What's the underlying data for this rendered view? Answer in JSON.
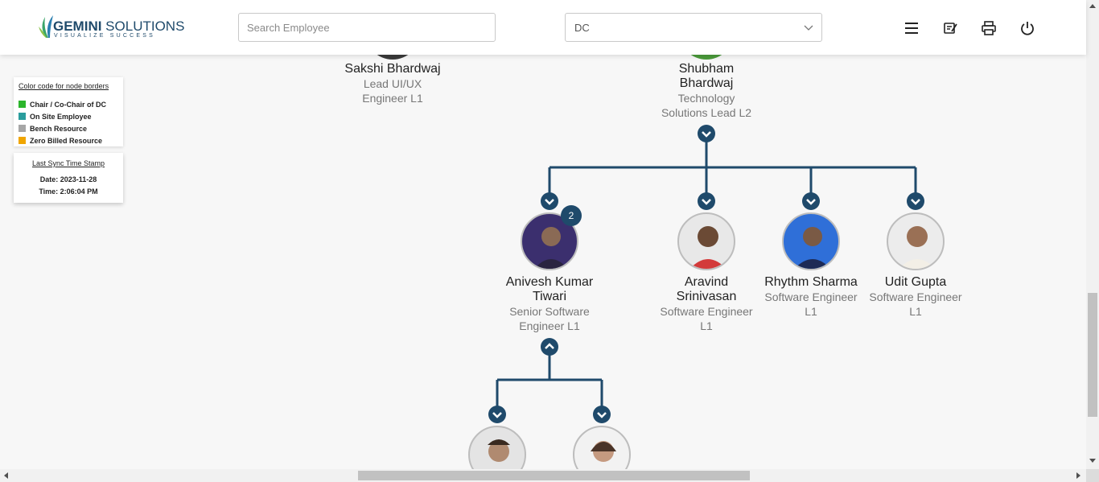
{
  "header": {
    "logo_main_bold": "GEMINI",
    "logo_main_rest": " SOLUTIONS",
    "logo_tagline": "VISUALIZE SUCCESS",
    "search_placeholder": "Search Employee",
    "search_value": "",
    "dropdown_value": "DC",
    "icons": [
      "menu-icon",
      "edit-note-icon",
      "print-icon",
      "power-icon"
    ]
  },
  "legend": {
    "title": "Color code for node borders",
    "items": [
      {
        "label": "Chair / Co-Chair of DC",
        "color": "#2bb52b"
      },
      {
        "label": "On Site Employee",
        "color": "#2a9d9d"
      },
      {
        "label": "Bench Resource",
        "color": "#a6a6a6"
      },
      {
        "label": "Zero Billed Resource",
        "color": "#f0a500"
      }
    ]
  },
  "sync": {
    "title": "Last Sync Time Stamp",
    "date": "Date: 2023-11-28",
    "time": "Time: 2:06:04 PM"
  },
  "colors": {
    "connector": "#1f4a6b",
    "accent": "#1f4a6b"
  },
  "tree": {
    "top_left": {
      "name": "Sakshi Bhardwaj",
      "title_line1": "Lead UI/UX",
      "title_line2": "Engineer L1"
    },
    "top_right": {
      "name_line1": "Shubham",
      "name_line2": "Bhardwaj",
      "title_line1": "Technology",
      "title_line2": "Solutions Lead L2"
    },
    "children": [
      {
        "name_line1": "Anivesh Kumar",
        "name_line2": "Tiwari",
        "title_line1": "Senior Software",
        "title_line2": "Engineer L1",
        "badge": "2"
      },
      {
        "name_line1": "Aravind",
        "name_line2": "Srinivasan",
        "title_line1": "Software Engineer",
        "title_line2": "L1"
      },
      {
        "name_line1": "Rhythm Sharma",
        "title_line1": "Software Engineer",
        "title_line2": "L1"
      },
      {
        "name_line1": "Udit Gupta",
        "title_line1": "Software Engineer",
        "title_line2": "L1"
      }
    ]
  }
}
